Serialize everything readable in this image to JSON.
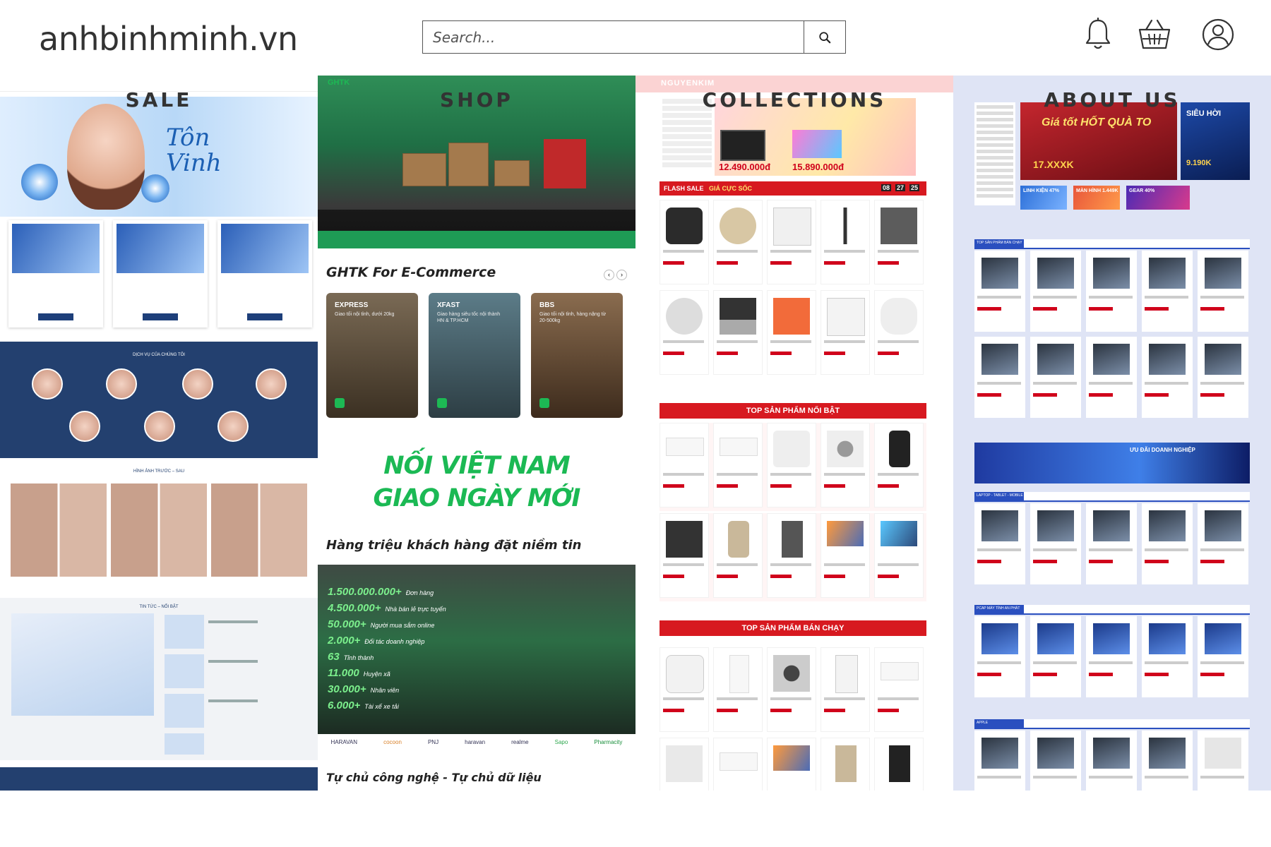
{
  "site": {
    "logo_text": "anhbinhminh.vn"
  },
  "search": {
    "placeholder": "Search..."
  },
  "header_icons": [
    "bell-icon",
    "basket-icon",
    "user-icon"
  ],
  "panels": [
    {
      "label": "SALE"
    },
    {
      "label": "SHOP"
    },
    {
      "label": "COLLECTIONS"
    },
    {
      "label": "ABOUT US"
    }
  ],
  "sale_panel": {
    "services_heading": "DỊCH VỤ CỦA CHÚNG TÔI",
    "before_after_heading": "HÌNH ẢNH TRƯỚC – SAU",
    "news_heading": "TIN TỨC – NỔI BẬT"
  },
  "shop_panel": {
    "brand": "GHTK",
    "ecommerce_title": "GHTK For E-Commerce",
    "cards": [
      {
        "title": "EXPRESS",
        "desc": "Giao tối nội tỉnh, dưới 20kg"
      },
      {
        "title": "XFAST",
        "desc": "Giao hàng siêu tốc nội thành HN & TP.HCM"
      },
      {
        "title": "BBS",
        "desc": "Giao tối nội tỉnh, hàng nặng từ 20-500kg"
      }
    ],
    "slogan_line1": "NỐI VIỆT NAM",
    "slogan_line2": "GIAO NGÀY MỚI",
    "trust_title": "Hàng triệu khách hàng đặt niềm tin",
    "stats": [
      {
        "value": "1.500.000.000+",
        "label": "Đơn hàng"
      },
      {
        "value": "4.500.000+",
        "label": "Nhà bán lẻ trực tuyến"
      },
      {
        "value": "50.000+",
        "label": "Người mua sắm online"
      },
      {
        "value": "2.000+",
        "label": "Đối tác doanh nghiệp"
      },
      {
        "value": "63",
        "label": "Tỉnh thành"
      },
      {
        "value": "11.000",
        "label": "Huyện xã"
      },
      {
        "value": "30.000+",
        "label": "Nhân viên"
      },
      {
        "value": "6.000+",
        "label": "Tài xế xe tải"
      }
    ],
    "partners": [
      "HARAVAN",
      "cocoon",
      "PNJ",
      "haravan",
      "realme",
      "Sapo",
      "Pharmacity"
    ],
    "tagline": "Tự chủ công nghệ - Tự chủ dữ liệu"
  },
  "collections_panel": {
    "brand": "NGUYENKIM",
    "banner_prices": [
      "12.490.000đ",
      "15.890.000đ"
    ],
    "flash_sale": "FLASH SALE",
    "flash_sub": "GIÁ CỰC SỐC",
    "countdown": [
      "08",
      "27",
      "25"
    ],
    "section_top": "TOP SẢN PHẨM NỔI BẬT",
    "section_best": "TOP SẢN PHẨM BÁN CHẠY"
  },
  "about_panel": {
    "banner_title": "Giá tốt HỐT QUÀ TO",
    "banner_price": "17.XXXK",
    "side_banner": "SIÊU HỜI",
    "side_price": "9.190K",
    "mini_banners": [
      "LINH KIỆN 47%",
      "MÀN HÌNH 1.449K",
      "GEAR 40%"
    ],
    "sections": [
      "TOP SẢN PHẨM BÁN CHẠY",
      "LAPTOP - TABLET - MOBILE",
      "PCAP MÁY TÍNH AN PHÁT",
      "APPLE"
    ],
    "promo": "ƯU ĐÃI DOANH NGHIỆP"
  }
}
